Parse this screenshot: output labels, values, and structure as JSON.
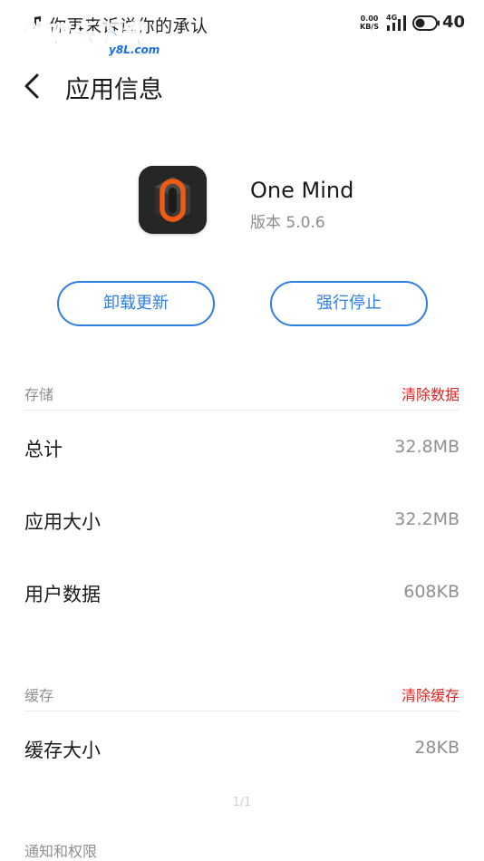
{
  "status_bar": {
    "notification_text": "你再来诉说你的承认",
    "net_speed_value": "0.00",
    "net_speed_unit": "KB/S",
    "network_type": "4G",
    "battery_level": "40",
    "watermark_main": "游吧乐下载",
    "watermark_sub": "y8L.com"
  },
  "header": {
    "title": "应用信息",
    "back_icon": "chevron-left-icon"
  },
  "app": {
    "name": "One Mind",
    "version": "版本 5.0.6",
    "icon": "app-icon-onemind",
    "accent_color": "#f05a13"
  },
  "actions": {
    "uninstall_updates": "卸载更新",
    "force_stop": "强行停止",
    "button_color": "#2f7de6"
  },
  "storage": {
    "label": "存储",
    "clear_action": "清除数据",
    "rows": [
      {
        "label": "总计",
        "value": "32.8MB"
      },
      {
        "label": "应用大小",
        "value": "32.2MB"
      },
      {
        "label": "用户数据",
        "value": "608KB"
      }
    ]
  },
  "cache": {
    "label": "缓存",
    "clear_action": "清除缓存",
    "rows": [
      {
        "label": "缓存大小",
        "value": "28KB"
      }
    ]
  },
  "page_indicator": "1/1",
  "notifications_section": {
    "label": "通知和权限"
  },
  "colors": {
    "danger": "#e02020",
    "secondary_text": "#8f8f8f"
  }
}
